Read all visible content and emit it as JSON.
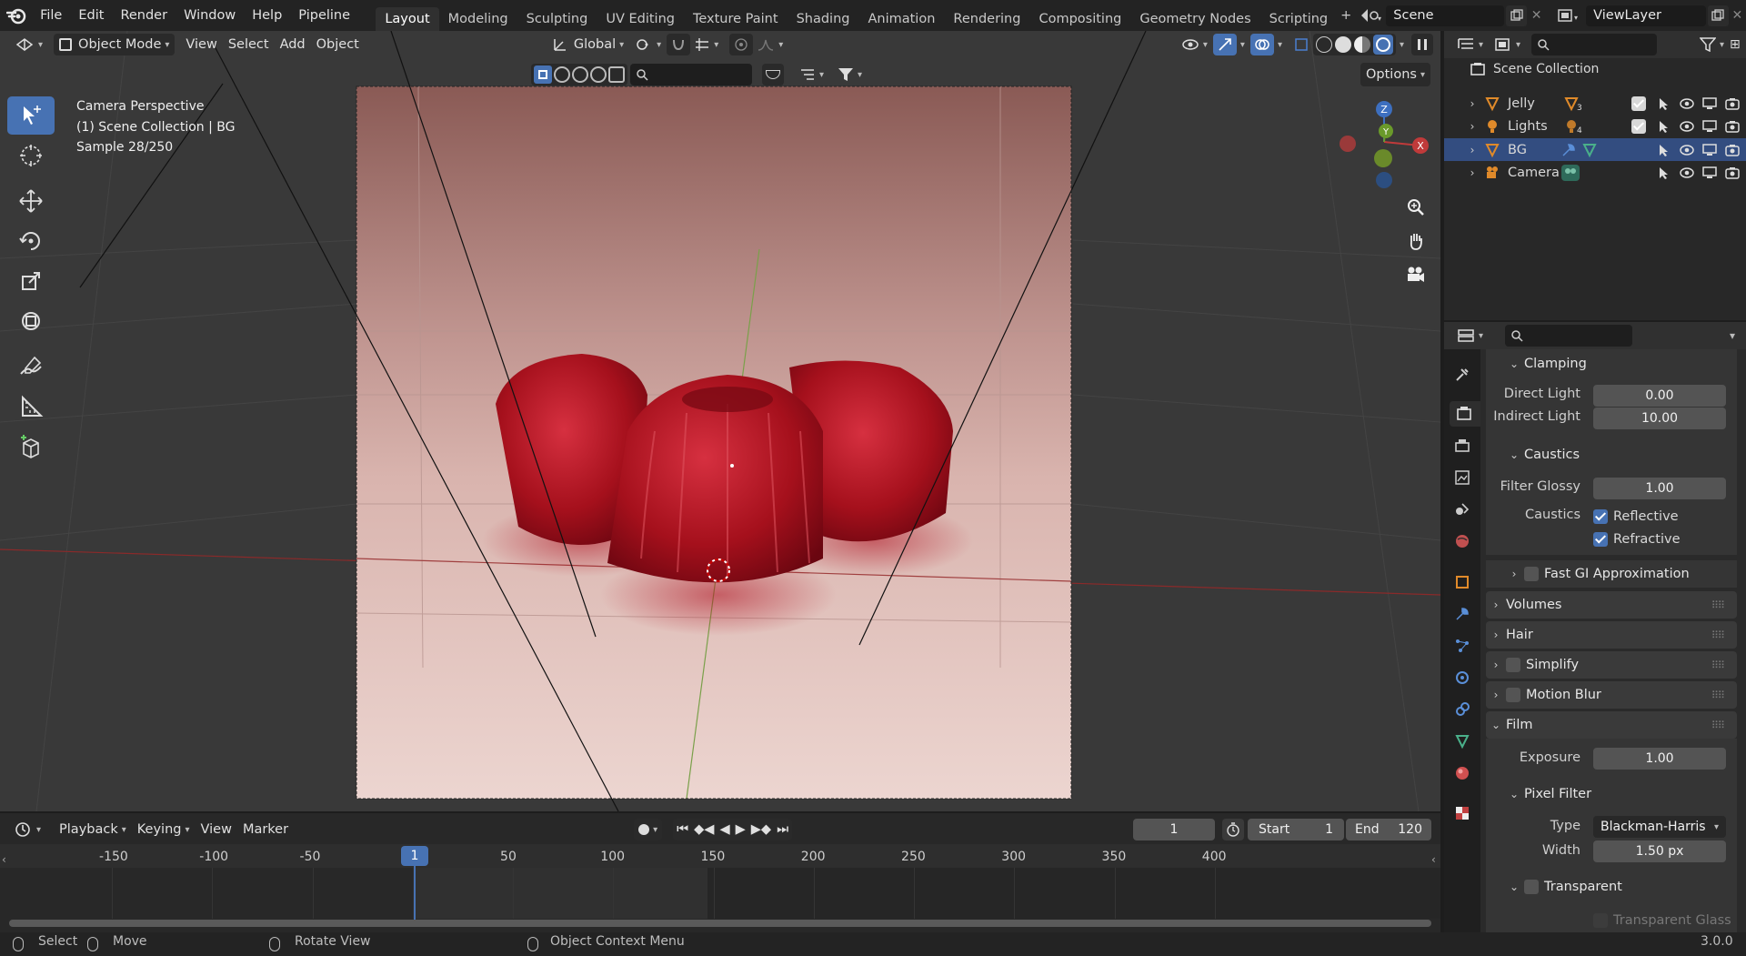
{
  "app": {
    "menus": [
      "File",
      "Edit",
      "Render",
      "Window",
      "Help",
      "Pipeline"
    ],
    "workspaces": [
      "Layout",
      "Modeling",
      "Sculpting",
      "UV Editing",
      "Texture Paint",
      "Shading",
      "Animation",
      "Rendering",
      "Compositing",
      "Geometry Nodes",
      "Scripting"
    ],
    "active_workspace": "Layout",
    "add_workspace": "+",
    "scene_name": "Scene",
    "view_layer": "ViewLayer",
    "version": "3.0.0"
  },
  "viewport_header": {
    "mode": "Object Mode",
    "menus": [
      "View",
      "Select",
      "Add",
      "Object"
    ],
    "transform_orientation": "Global",
    "options_label": "Options"
  },
  "viewport": {
    "overlay_lines": [
      "Camera Perspective",
      "(1) Scene Collection | BG",
      "Sample 28/250"
    ],
    "gizmo": {
      "z": "Z",
      "y": "Y",
      "x": "X"
    }
  },
  "outliner": {
    "root": "Scene Collection",
    "items": [
      {
        "name": "Jelly",
        "badge": "3",
        "selected": false
      },
      {
        "name": "Lights",
        "badge": "4",
        "selected": false
      },
      {
        "name": "BG",
        "badge": "",
        "selected": true
      },
      {
        "name": "Camera",
        "badge": "",
        "selected": false
      }
    ]
  },
  "properties": {
    "clamping": {
      "title": "Clamping",
      "direct_label": "Direct Light",
      "direct_value": "0.00",
      "indirect_label": "Indirect Light",
      "indirect_value": "10.00"
    },
    "caustics": {
      "title": "Caustics",
      "filter_label": "Filter Glossy",
      "filter_value": "1.00",
      "caustics_label": "Caustics",
      "reflective": "Reflective",
      "refractive": "Refractive"
    },
    "fast_gi": "Fast GI Approximation",
    "volumes": "Volumes",
    "hair": "Hair",
    "simplify": "Simplify",
    "motion_blur": "Motion Blur",
    "film": {
      "title": "Film",
      "exposure_label": "Exposure",
      "exposure_value": "1.00"
    },
    "pixel_filter": {
      "title": "Pixel Filter",
      "type_label": "Type",
      "type_value": "Blackman-Harris",
      "width_label": "Width",
      "width_value": "1.50 px"
    },
    "transparent": {
      "title": "Transparent",
      "glass": "Transparent Glass"
    }
  },
  "timeline": {
    "menus": [
      "Playback",
      "Keying",
      "View",
      "Marker"
    ],
    "current_frame": "1",
    "start_label": "Start",
    "start_value": "1",
    "end_label": "End",
    "end_value": "120",
    "ruler": [
      "-150",
      "-100",
      "-50",
      "1",
      "50",
      "100",
      "150",
      "200",
      "250",
      "300",
      "350",
      "400"
    ],
    "playhead": "1"
  },
  "statusbar": {
    "select": "Select",
    "move": "Move",
    "rotate": "Rotate View",
    "context": "Object Context Menu"
  },
  "colors": {
    "accent": "#4772b3",
    "selected_row": "#334d80",
    "jelly": "#b0101c",
    "bg_pink": "#e8c8c2"
  }
}
